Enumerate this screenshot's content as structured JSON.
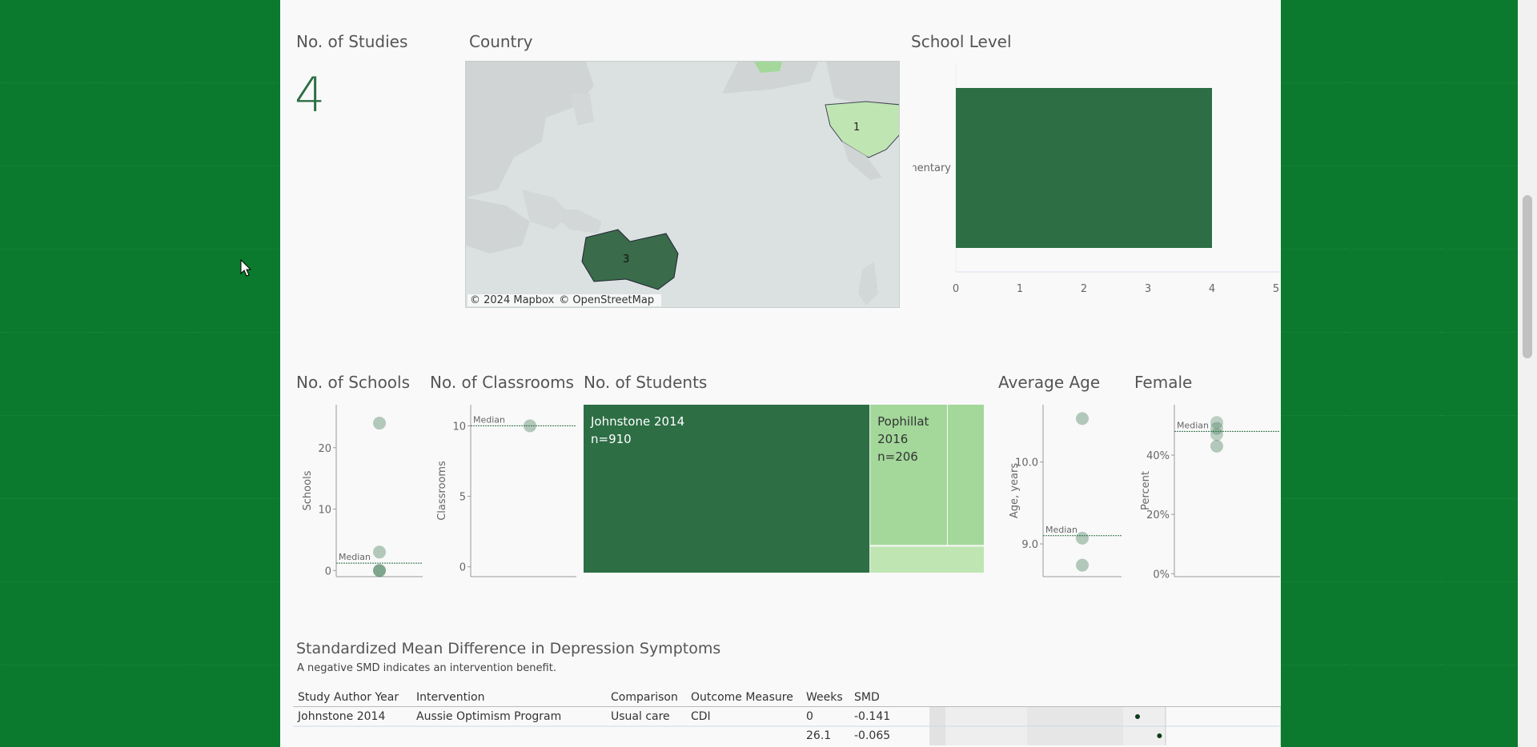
{
  "colors": {
    "background": "#0b7a2e",
    "dark_green": "#2d6e45",
    "light_green": "#a3d89a",
    "lighter_green": "#bfe5b3",
    "text": "#555555"
  },
  "kpi": {
    "title": "No. of Studies",
    "value": "4"
  },
  "map": {
    "title": "Country",
    "labels": [
      "1",
      "3"
    ],
    "attribution": [
      "© 2024 Mapbox",
      "© OpenStreetMap"
    ]
  },
  "school_level": {
    "title": "School Level",
    "chart_data": {
      "type": "bar",
      "orientation": "horizontal",
      "categories": [
        "Elementary"
      ],
      "values": [
        4
      ],
      "xlim": [
        0,
        5
      ],
      "xticks": [
        "0",
        "1",
        "2",
        "3",
        "4",
        "5"
      ]
    }
  },
  "schools": {
    "title": "No. of Schools",
    "ylabel": "Schools",
    "yticks": [
      "20",
      "10",
      "0"
    ],
    "median_label": "Median",
    "chart_data": {
      "type": "scatter",
      "values": [
        24,
        3,
        0
      ],
      "median": 1.2,
      "ylim": [
        -1,
        27
      ]
    }
  },
  "classrooms": {
    "title": "No. of Classrooms",
    "ylabel": "Classrooms",
    "yticks": [
      "10",
      "5",
      "0"
    ],
    "median_label": "Median",
    "chart_data": {
      "type": "scatter",
      "values": [
        10
      ],
      "median": 10,
      "ylim": [
        -0.7,
        11.5
      ]
    }
  },
  "students": {
    "title": "No. of Students",
    "chart_data": {
      "type": "treemap",
      "items": [
        {
          "label_lines": [
            "Johnstone 2014",
            "n=910"
          ],
          "value": 910
        },
        {
          "label_lines": [
            "Pophillat",
            "2016",
            "n=206"
          ],
          "value": 206
        },
        {
          "label_lines": [],
          "value": 98
        },
        {
          "label_lines": [],
          "value": 60
        }
      ]
    }
  },
  "age": {
    "title": "Average Age",
    "ylabel": "Age, years",
    "yticks": [
      "10.0",
      "9.0"
    ],
    "median_label": "Median",
    "chart_data": {
      "type": "scatter",
      "values": [
        10.53,
        9.07,
        8.74
      ],
      "median": 9.1,
      "ylim": [
        8.6,
        10.7
      ]
    }
  },
  "female": {
    "title": "Female",
    "ylabel": "Percent",
    "yticks": [
      "40%",
      "20%",
      "0%"
    ],
    "median_label": "Median",
    "chart_data": {
      "type": "scatter",
      "values": [
        51,
        49,
        47,
        43
      ],
      "median": 48,
      "ylim": [
        -1,
        57
      ]
    }
  },
  "smd": {
    "title": "Standardized Mean Difference in Depression Symptoms",
    "subtitle": "A negative SMD indicates an intervention benefit.",
    "columns": [
      "Study Author Year",
      "Intervention",
      "Comparison",
      "Outcome Measure",
      "Weeks",
      "SMD"
    ],
    "rows": [
      {
        "study": "Johnstone 2014",
        "intervention": "Aussie Optimism Program",
        "comparison": "Usual care",
        "outcome": "CDI",
        "weeks": "0",
        "smd": "-0.141"
      },
      {
        "study": "",
        "intervention": "",
        "comparison": "",
        "outcome": "",
        "weeks": "26.1",
        "smd": "-0.065"
      }
    ]
  }
}
